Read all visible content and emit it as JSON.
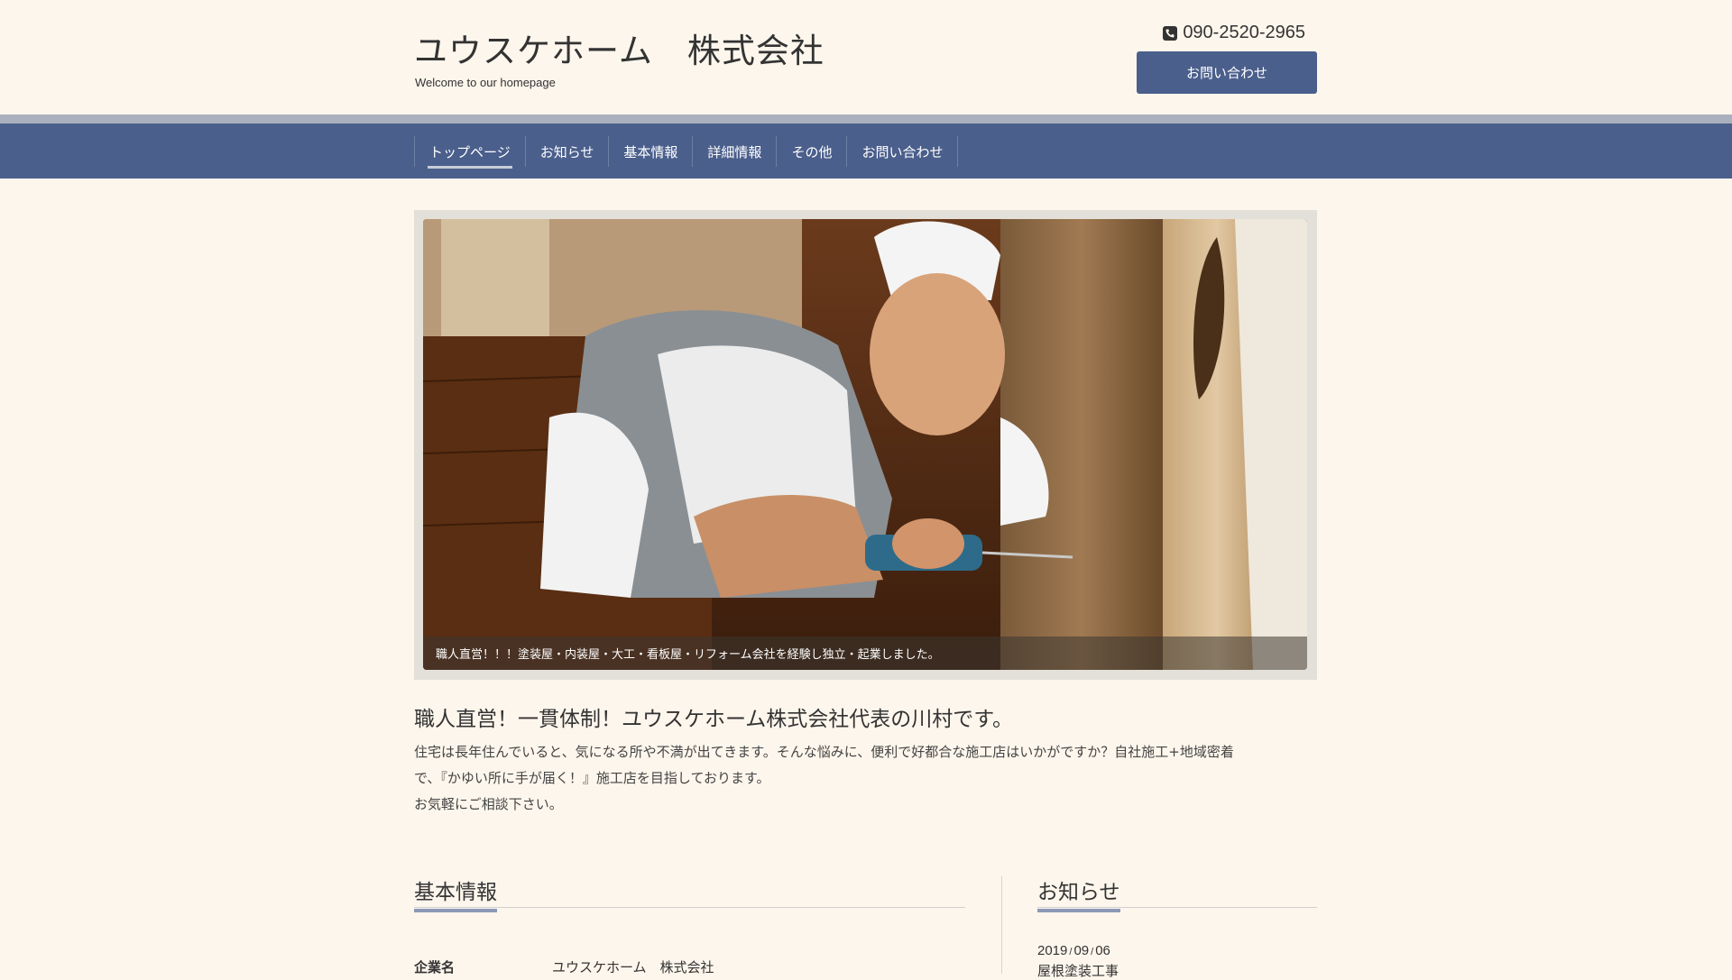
{
  "header": {
    "title": "ユウスケホーム　株式会社",
    "subtitle": "Welcome to our homepage",
    "phone": "090-2520-2965",
    "contact_button": "お問い合わせ"
  },
  "nav": {
    "items": [
      {
        "label": "トップページ",
        "active": true
      },
      {
        "label": "お知らせ"
      },
      {
        "label": "基本情報"
      },
      {
        "label": "詳細情報"
      },
      {
        "label": "その他"
      },
      {
        "label": "お問い合わせ"
      }
    ]
  },
  "hero": {
    "caption": "職人直営！！！塗装屋・内装屋・大工・看板屋・リフォーム会社を経験し独立・起業しました。"
  },
  "intro": {
    "heading": "職人直営！一貫体制！ユウスケホーム株式会社代表の川村です。",
    "line1": "住宅は長年住んでいると、気になる所や不満が出てきます。そんな悩みに、便利で好都合な施工店はいかがですか？自社施工+地域密着",
    "line2": "で、『かゆい所に手が届く！』施工店を目指しております。",
    "line3": "お気軽にご相談下さい。"
  },
  "basic_info": {
    "title": "基本情報",
    "rows": [
      {
        "key": "企業名",
        "value": "ユウスケホーム　株式会社"
      }
    ]
  },
  "news": {
    "title": "お知らせ",
    "items": [
      {
        "year": "2019",
        "month": "09",
        "day": "06",
        "title": "屋根塗装工事"
      }
    ]
  },
  "colors": {
    "background": "#fdf6ec",
    "nav": "#4b5f8c",
    "accent": "#8d98b6"
  }
}
